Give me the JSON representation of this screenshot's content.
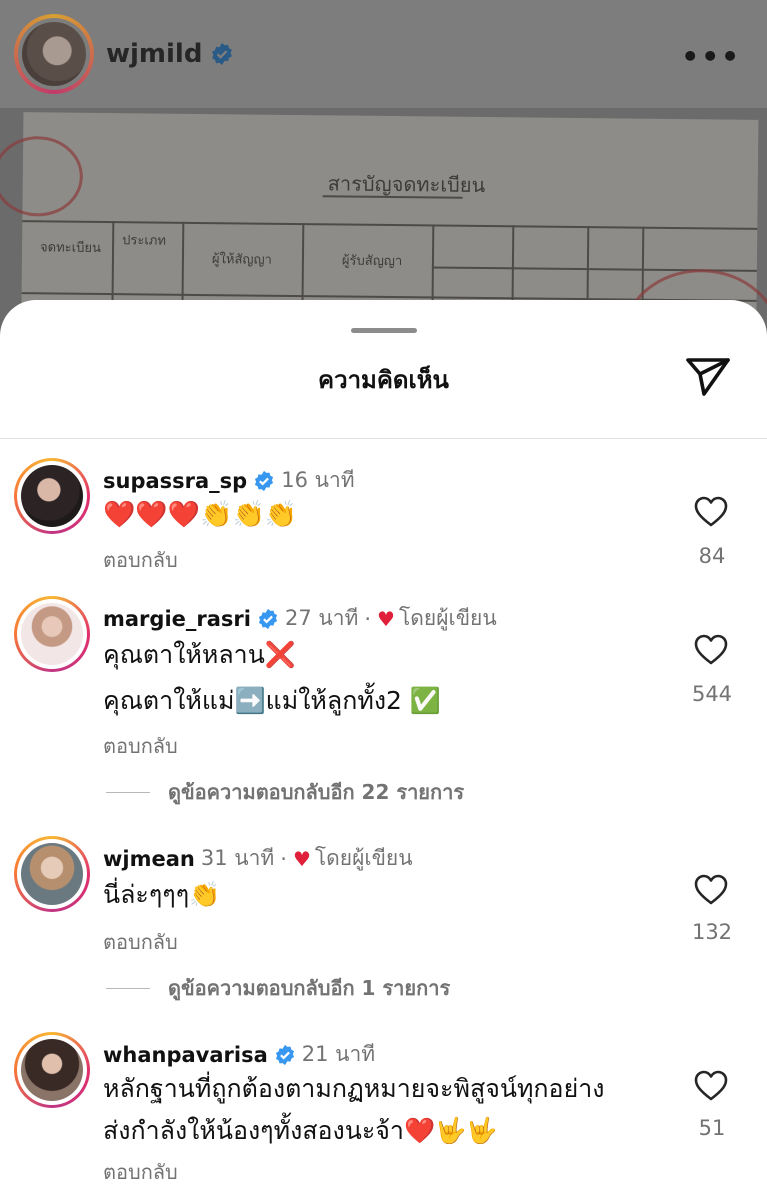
{
  "post": {
    "username": "wjmild",
    "more_icon": "ellipsis-icon"
  },
  "document": {
    "title": "สารบัญจดทะเบียน",
    "header_left": "จดทะเบียน",
    "header_col2": "ประเภท",
    "header_col3": "ผู้ให้สัญญา",
    "header_col4": "ผู้รับสัญญา"
  },
  "sheet": {
    "title": "ความคิดเห็น",
    "share_icon": "send-icon"
  },
  "comments": [
    {
      "username": "supassra_sp",
      "verified": true,
      "time": "16 นาที",
      "by_author": "",
      "lines": [
        "❤️❤️❤️👏👏👏"
      ],
      "reply_label": "ตอบกลับ",
      "likes": "84"
    },
    {
      "username": "margie_rasri",
      "verified": true,
      "time": "27 นาที",
      "by_author": "โดยผู้เขียน",
      "lines": [
        "คุณตาให้หลาน❌",
        "คุณตาให้แม่➡️แม่ให้ลูกทั้ง2 ✅"
      ],
      "reply_label": "ตอบกลับ",
      "likes": "544",
      "view_replies": "ดูข้อความตอบกลับอีก 22 รายการ"
    },
    {
      "username": "wjmean",
      "verified": false,
      "time": "31 นาที",
      "by_author": "โดยผู้เขียน",
      "lines": [
        "นี่ล่ะๆๆๆ👏"
      ],
      "reply_label": "ตอบกลับ",
      "likes": "132",
      "view_replies": "ดูข้อความตอบกลับอีก 1 รายการ"
    },
    {
      "username": "whanpavarisa",
      "verified": true,
      "time": "21 นาที",
      "by_author": "",
      "lines": [
        "หลักฐานที่ถูกต้องตามกฏหมายจะพิสูจน์ทุกอย่าง",
        "ส่งกำลังให้น้องๆทั้งสองนะจ้า❤️🤟🤟"
      ],
      "reply_label": "ตอบกลับ",
      "likes": "51"
    }
  ],
  "colors": {
    "verified": "#3897f0",
    "heart": "#e0203a",
    "muted": "#737373"
  }
}
